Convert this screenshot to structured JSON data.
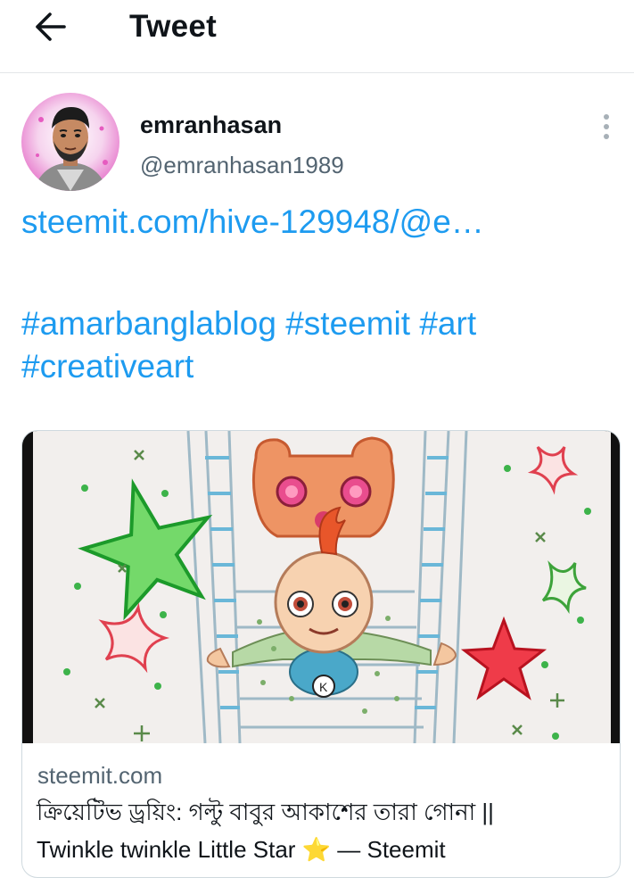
{
  "header": {
    "title": "Tweet",
    "back_icon": "arrow-left-icon"
  },
  "author": {
    "display_name": "emranhasan",
    "handle": "@emranhasan1989",
    "more_icon": "more-vertical-icon"
  },
  "tweet": {
    "link_text": "steemit.com/hive-129948/@e…",
    "hashtags": [
      "#amarbanglablog",
      "#steemit",
      "#art",
      "#creativeart"
    ]
  },
  "card": {
    "domain": "steemit.com",
    "title_line1": "ক্রিয়েটিভ ড্রয়িং: গল্টু বাবুর আকাশের তারা গোনা ||",
    "title_line2": "Twinkle twinkle Little Star ⭐ — Steemit"
  },
  "colors": {
    "accent": "#1d9bf0",
    "secondary_text": "#536471",
    "border": "#cfd9de"
  }
}
